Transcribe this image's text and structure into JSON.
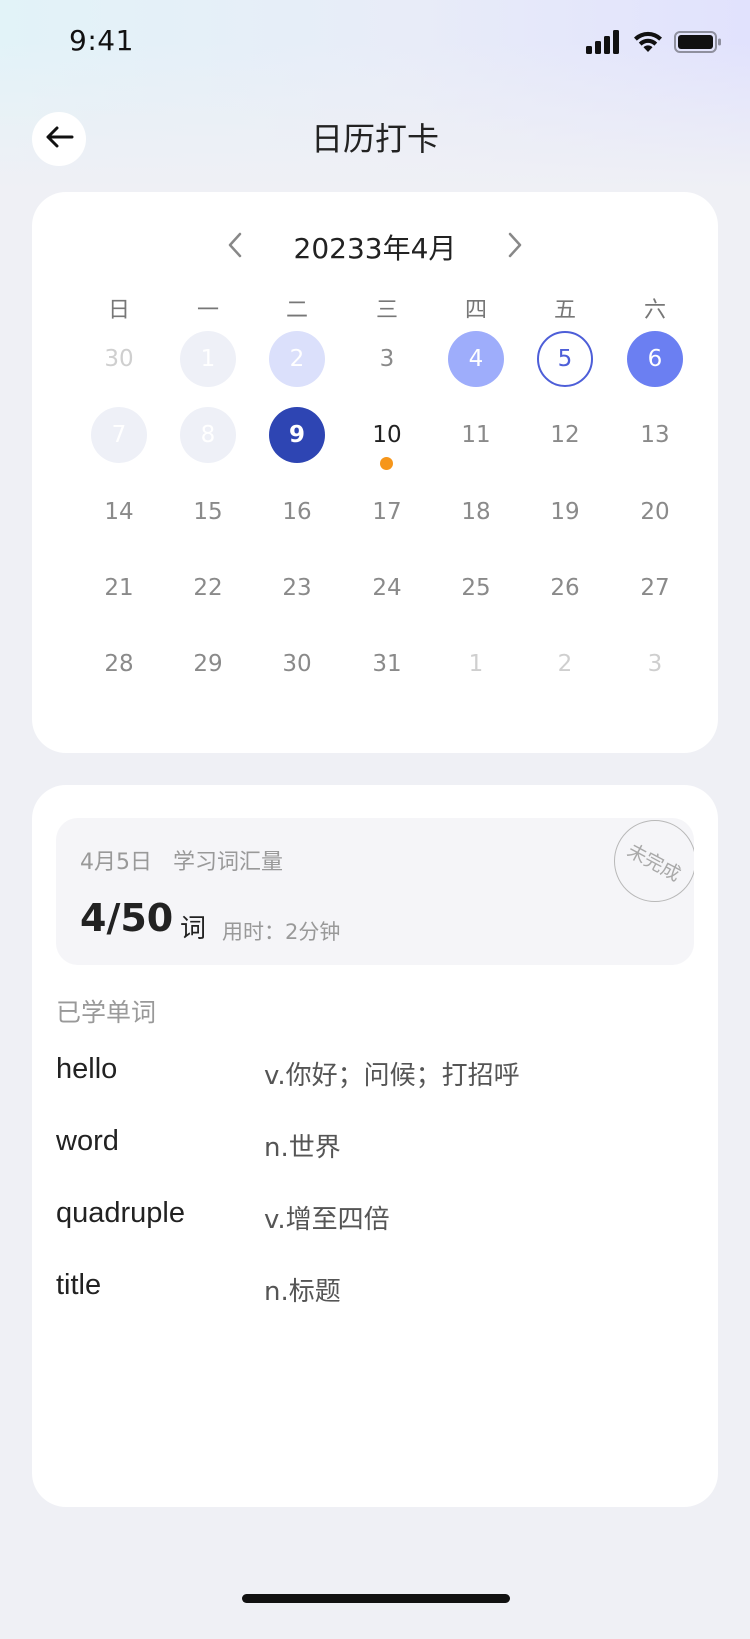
{
  "status_bar": {
    "time": "9:41"
  },
  "header": {
    "title": "日历打卡",
    "back_icon": "arrow-left-icon"
  },
  "calendar": {
    "month_title": "20233年4月",
    "prev_icon": "chevron-left-icon",
    "next_icon": "chevron-right-icon",
    "weekdays": [
      "日",
      "一",
      "二",
      "三",
      "四",
      "五",
      "六"
    ],
    "weeks": [
      [
        {
          "label": "30",
          "state": "muted"
        },
        {
          "label": "1",
          "state": "gray-fill"
        },
        {
          "label": "2",
          "state": "light-fill"
        },
        {
          "label": "3",
          "state": "normal"
        },
        {
          "label": "4",
          "state": "mid-fill"
        },
        {
          "label": "5",
          "state": "outline"
        },
        {
          "label": "6",
          "state": "blue-fill"
        }
      ],
      [
        {
          "label": "7",
          "state": "gray-fill"
        },
        {
          "label": "8",
          "state": "gray-fill"
        },
        {
          "label": "9",
          "state": "dark-fill"
        },
        {
          "label": "10",
          "state": "today",
          "dot": true
        },
        {
          "label": "11",
          "state": "normal"
        },
        {
          "label": "12",
          "state": "normal"
        },
        {
          "label": "13",
          "state": "normal"
        }
      ],
      [
        {
          "label": "14",
          "state": "normal"
        },
        {
          "label": "15",
          "state": "normal"
        },
        {
          "label": "16",
          "state": "normal"
        },
        {
          "label": "17",
          "state": "normal"
        },
        {
          "label": "18",
          "state": "normal"
        },
        {
          "label": "19",
          "state": "normal"
        },
        {
          "label": "20",
          "state": "normal"
        }
      ],
      [
        {
          "label": "21",
          "state": "normal"
        },
        {
          "label": "22",
          "state": "normal"
        },
        {
          "label": "23",
          "state": "normal"
        },
        {
          "label": "24",
          "state": "normal"
        },
        {
          "label": "25",
          "state": "normal"
        },
        {
          "label": "26",
          "state": "normal"
        },
        {
          "label": "27",
          "state": "normal"
        }
      ],
      [
        {
          "label": "28",
          "state": "normal"
        },
        {
          "label": "29",
          "state": "normal"
        },
        {
          "label": "30",
          "state": "normal"
        },
        {
          "label": "31",
          "state": "normal"
        },
        {
          "label": "1",
          "state": "muted"
        },
        {
          "label": "2",
          "state": "muted"
        },
        {
          "label": "3",
          "state": "muted"
        }
      ]
    ],
    "colors": {
      "accent_dark": "#2e45b3",
      "accent": "#6b7ff2",
      "accent_mid": "#9eadfb",
      "accent_light": "#dbe0fb",
      "dot": "#f6961a"
    }
  },
  "summary": {
    "date": "4月5日",
    "label": "学习词汇量",
    "count": "4/50",
    "unit": "词",
    "time": "用时：2分钟",
    "stamp": "未完成"
  },
  "learned": {
    "title": "已学单词",
    "words": [
      {
        "en": "hello",
        "cn": "v.你好；问候；打招呼"
      },
      {
        "en": "word",
        "cn": "n.世界"
      },
      {
        "en": "quadruple",
        "cn": "v.增至四倍"
      },
      {
        "en": "title",
        "cn": "n.标题"
      }
    ]
  }
}
